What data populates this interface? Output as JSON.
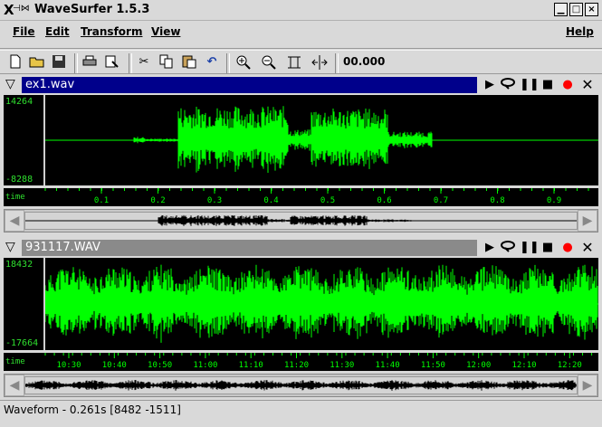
{
  "window": {
    "title": "WaveSurfer 1.5.3",
    "close_glyph": "×"
  },
  "menu": {
    "file": "File",
    "edit": "Edit",
    "transform": "Transform",
    "view": "View",
    "help": "Help"
  },
  "toolbar": {
    "time_readout": "00.000"
  },
  "panes": [
    {
      "title": "ex1.wav",
      "ymax": "14264",
      "ymin": "-8288",
      "time_label": "time",
      "ticks": [
        "0.1",
        "0.2",
        "0.3",
        "0.4",
        "0.5",
        "0.6",
        "0.7",
        "0.8",
        "0.9"
      ],
      "header_color": "#00008b"
    },
    {
      "title": "931117.WAV",
      "ymax": "18432",
      "ymin": "-17664",
      "time_label": "time",
      "ticks": [
        "10:30",
        "10:40",
        "10:50",
        "11:00",
        "11:10",
        "11:20",
        "11:30",
        "11:40",
        "11:50",
        "12:00",
        "12:10",
        "12:20"
      ],
      "header_color": "#8a8a8a"
    }
  ],
  "status": "Waveform - 0.261s [8482 -1511]",
  "colors": {
    "waveform": "#00ff00",
    "record": "#ff0000"
  }
}
